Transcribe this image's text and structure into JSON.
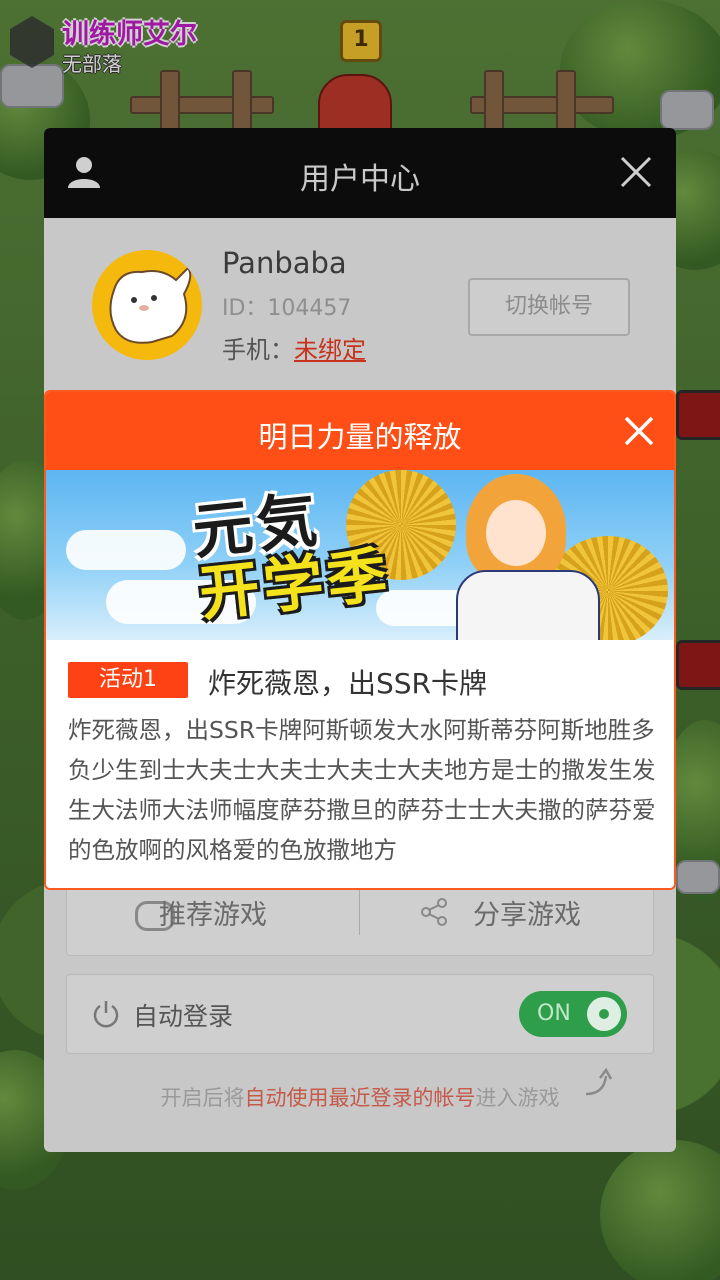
{
  "game": {
    "player_name": "训练师艾尔",
    "clan": "无部落",
    "crown_level": "1"
  },
  "user_center": {
    "title": "用户中心",
    "username": "Panbaba",
    "id_text": "ID：104457",
    "phone_label": "手机：",
    "phone_status": "未绑定",
    "switch_account": "切换帐号",
    "recommend_games": "推荐游戏",
    "share_game": "分享游戏",
    "auto_login_label": "自动登录",
    "auto_login_state": "ON",
    "hint_prefix": "开启后将",
    "hint_highlight": "自动使用最近登录的帐号",
    "hint_suffix": "进入游戏"
  },
  "activity_popup": {
    "title": "明日力量的释放",
    "banner_line1": "元気",
    "banner_line2": "开学季",
    "tag": "活动1",
    "headline": "炸死薇恩，出SSR卡牌",
    "body": "炸死薇恩，出SSR卡牌阿斯顿发大水阿斯蒂芬阿斯地胜多负少生到士大夫士大夫士大夫士大夫地方是士的撒发生发生大法师大法师幅度萨芬撒旦的萨芬士士大夫撒的萨芬爱的色放啊的风格爱的色放撒地方"
  },
  "colors": {
    "accent_orange": "#ff4f16",
    "toggle_green": "#2f9e4a",
    "warning_red": "#c7321c",
    "player_name_magenta": "#c21ec6"
  }
}
